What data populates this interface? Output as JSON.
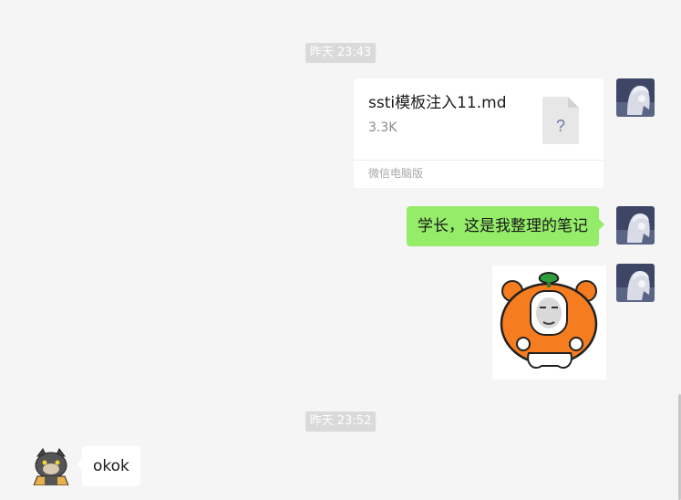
{
  "messages": {
    "timestamp_1": "昨天 23:43",
    "file": {
      "name": "ssti模板注入11.md",
      "size": "3.3K",
      "icon_glyph": "?",
      "source": "微信电脑版"
    },
    "text_out": "学长，这是我整理的笔记",
    "timestamp_2": "昨天 23:52",
    "text_in": "okok"
  },
  "colors": {
    "background": "#f5f5f5",
    "bubble_out": "#95ec69",
    "bubble_in": "#ffffff",
    "timestamp_bg": "#dadada"
  },
  "icons": {
    "self_avatar": "anime-character-avatar",
    "contact_avatar": "cartoon-cat-avatar",
    "file_type": "unknown-file-icon",
    "sticker": "persimmon-bear-sticker"
  }
}
